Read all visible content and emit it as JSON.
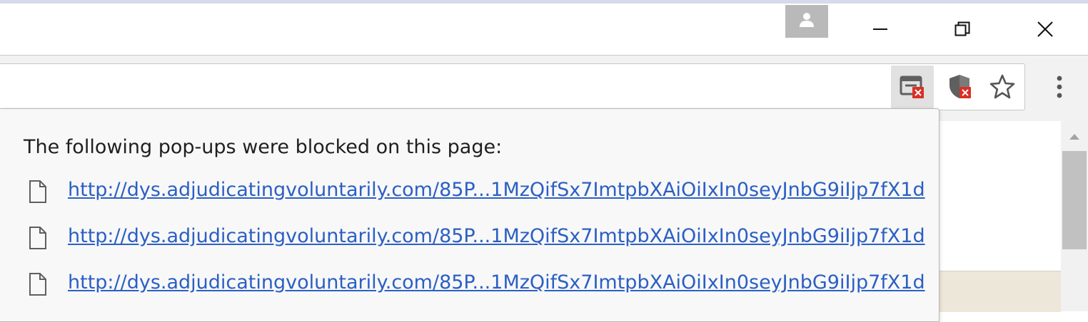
{
  "window": {
    "controls": {
      "profile_icon": "person-icon",
      "minimize_icon": "minimize-icon",
      "restore_icon": "restore-icon",
      "close_icon": "close-icon"
    }
  },
  "toolbar": {
    "icons": [
      "popup-blocked-icon",
      "shield-blocked-icon",
      "star-icon",
      "kebab-menu-icon"
    ],
    "blocked_badge_color": "#d93025"
  },
  "popup_bubble": {
    "title": "The following pop-ups were blocked on this page:",
    "items": [
      {
        "url": "http://dys.adjudicatingvoluntarily.com/85P...1MzQifSx7ImtpbXAiOiIxIn0seyJnbG9iIjp7fX1d"
      },
      {
        "url": "http://dys.adjudicatingvoluntarily.com/85P...1MzQifSx7ImtpbXAiOiIxIn0seyJnbG9iIjp7fX1d"
      },
      {
        "url": "http://dys.adjudicatingvoluntarily.com/85P...1MzQifSx7ImtpbXAiOiIxIn0seyJnbG9iIjp7fX1d"
      }
    ]
  },
  "colors": {
    "link": "#2b5fc4",
    "profile_button": "#b9b9b9"
  }
}
